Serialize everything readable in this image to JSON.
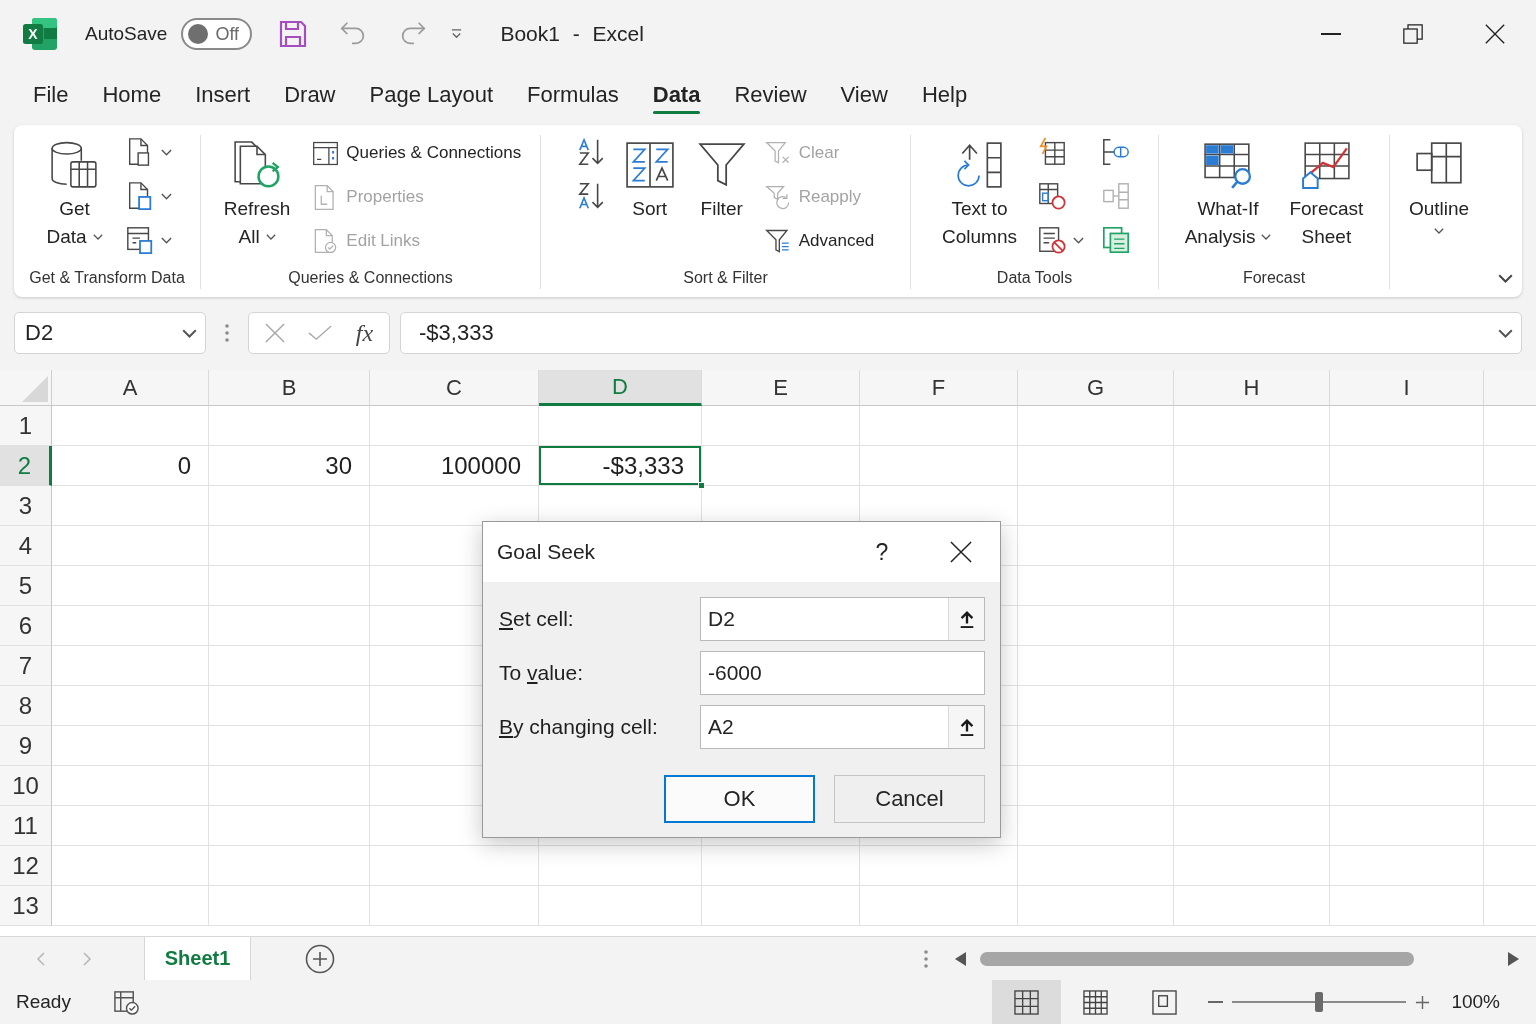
{
  "title_bar": {
    "app_logo": "X",
    "autosave_label": "AutoSave",
    "autosave": {
      "label": "Off",
      "on": false
    },
    "document_title": "Book1 - Excel"
  },
  "menu_tabs": [
    {
      "label": "File",
      "selected": false
    },
    {
      "label": "Home",
      "selected": false
    },
    {
      "label": "Insert",
      "selected": false
    },
    {
      "label": "Draw",
      "selected": false
    },
    {
      "label": "Page Layout",
      "selected": false
    },
    {
      "label": "Formulas",
      "selected": false
    },
    {
      "label": "Data",
      "selected": true
    },
    {
      "label": "Review",
      "selected": false
    },
    {
      "label": "View",
      "selected": false
    },
    {
      "label": "Help",
      "selected": false
    }
  ],
  "ribbon": {
    "groups": [
      {
        "label": "Get & Transform Data",
        "items": [
          {
            "kind": "large",
            "lines": [
              "Get",
              "Data"
            ],
            "dropdown": true
          },
          {
            "kind": "stack",
            "buttons": [
              {
                "dropdown": true,
                "disabled": false
              },
              {
                "dropdown": true,
                "disabled": false
              },
              {
                "dropdown": true,
                "disabled": false
              }
            ]
          }
        ]
      },
      {
        "label": "Queries & Connections",
        "items": [
          {
            "kind": "large",
            "lines": [
              "Refresh",
              "All"
            ],
            "dropdown": true
          },
          {
            "kind": "list",
            "buttons": [
              {
                "label": "Queries & Connections",
                "disabled": false
              },
              {
                "label": "Properties",
                "disabled": true
              },
              {
                "label": "Edit Links",
                "disabled": true
              }
            ]
          }
        ]
      },
      {
        "label": "Sort & Filter",
        "items": [
          {
            "kind": "stack",
            "buttons": [
              {
                "dropdown": false,
                "disabled": false
              },
              {
                "dropdown": false,
                "disabled": false
              }
            ]
          },
          {
            "kind": "large",
            "lines": [
              "Sort"
            ],
            "dropdown": false
          },
          {
            "kind": "large",
            "lines": [
              "Filter"
            ],
            "dropdown": false
          },
          {
            "kind": "list",
            "buttons": [
              {
                "label": "Clear",
                "disabled": true
              },
              {
                "label": "Reapply",
                "disabled": true
              },
              {
                "label": "Advanced",
                "disabled": false
              }
            ]
          }
        ]
      },
      {
        "label": "Data Tools",
        "items": [
          {
            "kind": "large",
            "lines": [
              "Text to",
              "Columns"
            ],
            "dropdown": false
          },
          {
            "kind": "stack",
            "buttons": [
              {
                "dropdown": false,
                "disabled": false
              },
              {
                "dropdown": false,
                "disabled": false
              },
              {
                "dropdown": true,
                "disabled": false
              }
            ]
          },
          {
            "kind": "stack",
            "buttons": [
              {
                "dropdown": false,
                "disabled": false
              },
              {
                "dropdown": false,
                "disabled": true
              },
              {
                "dropdown": false,
                "disabled": false
              }
            ]
          }
        ]
      },
      {
        "label": "Forecast",
        "items": [
          {
            "kind": "large",
            "lines": [
              "What-If",
              "Analysis"
            ],
            "dropdown": true
          },
          {
            "kind": "large",
            "lines": [
              "Forecast",
              "Sheet"
            ],
            "dropdown": false
          }
        ]
      },
      {
        "items": [
          {
            "kind": "large",
            "lines": [
              "Outline"
            ],
            "dropdown": true
          }
        ]
      }
    ]
  },
  "formula_bar": {
    "name_box": "D2",
    "function_label": "fx",
    "formula": "-$3,333"
  },
  "sheet": {
    "columns": [
      {
        "label": "A",
        "selected": false
      },
      {
        "label": "B",
        "selected": false
      },
      {
        "label": "C",
        "selected": false
      },
      {
        "label": "D",
        "selected": true
      },
      {
        "label": "E",
        "selected": false
      },
      {
        "label": "F",
        "selected": false
      },
      {
        "label": "G",
        "selected": false
      },
      {
        "label": "H",
        "selected": false
      },
      {
        "label": "I",
        "selected": false
      }
    ],
    "rows": [
      {
        "label": "1",
        "selected": false
      },
      {
        "label": "2",
        "selected": true,
        "cells": [
          {
            "value": "0",
            "active": false
          },
          {
            "value": "30",
            "active": false
          },
          {
            "value": "100000",
            "active": false
          },
          {
            "value": "-$3,333",
            "active": true
          }
        ]
      },
      {
        "label": "3",
        "selected": false
      },
      {
        "label": "4",
        "selected": false
      },
      {
        "label": "5",
        "selected": false
      },
      {
        "label": "6",
        "selected": false
      },
      {
        "label": "7",
        "selected": false
      },
      {
        "label": "8",
        "selected": false
      },
      {
        "label": "9",
        "selected": false
      },
      {
        "label": "10",
        "selected": false
      },
      {
        "label": "11",
        "selected": false
      },
      {
        "label": "12",
        "selected": false
      },
      {
        "label": "13",
        "selected": false
      }
    ]
  },
  "dialog": {
    "title": "Goal Seek",
    "help": "?",
    "fields": [
      {
        "kind": "reference",
        "label": {
          "key": "S",
          "after": "et cell:"
        },
        "value": "D2"
      },
      {
        "kind": "number",
        "label": {
          "before": "To ",
          "key": "v",
          "after": "alue:"
        },
        "value": "-6000"
      },
      {
        "kind": "reference",
        "label": {
          "key": "B",
          "after": "y changing cell:"
        },
        "value": "A2"
      }
    ],
    "buttons": [
      {
        "label": "OK",
        "default": true
      },
      {
        "label": "Cancel",
        "default": false
      }
    ]
  },
  "sheet_tabs": [
    {
      "label": "Sheet1",
      "selected": true
    }
  ],
  "status_bar": {
    "status": "Ready",
    "views": [
      {
        "selected": true
      },
      {
        "selected": false
      },
      {
        "selected": false
      }
    ],
    "zoom": {
      "level": 0.5,
      "reading": "100%"
    }
  }
}
